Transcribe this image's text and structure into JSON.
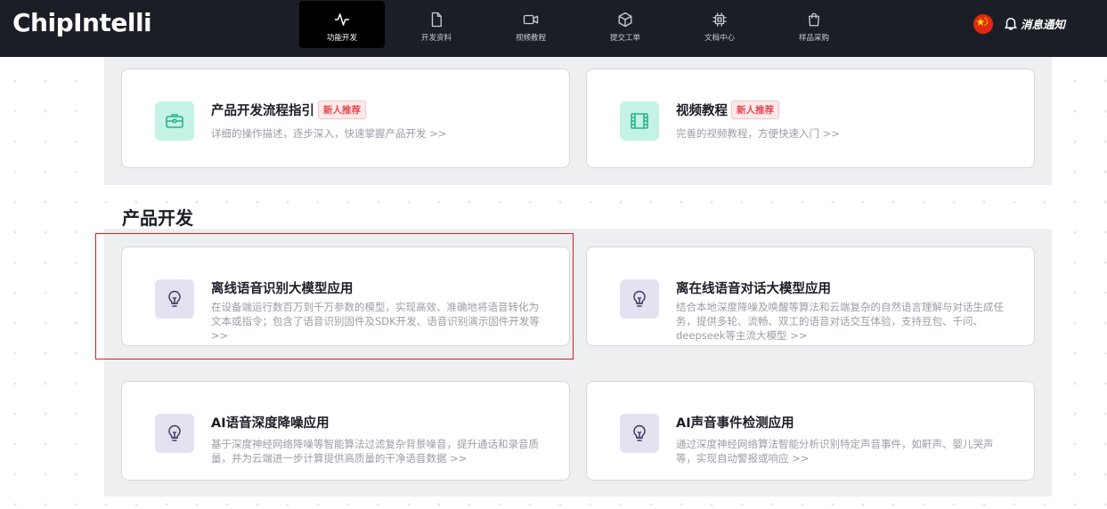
{
  "header": {
    "logo": "ChipIntelli",
    "nav": [
      {
        "label": "功能开发",
        "icon": "activity-pulse-icon",
        "active": true
      },
      {
        "label": "开发资料",
        "icon": "document-icon",
        "active": false
      },
      {
        "label": "视频教程",
        "icon": "video-camera-icon",
        "active": false
      },
      {
        "label": "提交工单",
        "icon": "box-3d-icon",
        "active": false
      },
      {
        "label": "文档中心",
        "icon": "chip-icon",
        "active": false
      },
      {
        "label": "样品采购",
        "icon": "shopping-bag-icon",
        "active": false
      }
    ],
    "notify_label": "消息通知",
    "flag_icon": "china-flag-icon"
  },
  "top_cards": [
    {
      "title": "产品开发流程指引",
      "badge": "新人推荐",
      "desc": "详细的操作描述，逐步深入，快速掌握产品开发 >>",
      "icon": "toolbox-icon"
    },
    {
      "title": "视频教程",
      "badge": "新人推荐",
      "desc": "完善的视频教程，方便快速入门 >>",
      "icon": "film-icon"
    }
  ],
  "section": {
    "title": "产品开发"
  },
  "product_cards": [
    {
      "title": "离线语音识别大模型应用",
      "desc": "在设备端运行数百万到千万参数的模型，实现高效、准确地将语音转化为文本或指令；包含了语音识别固件及SDK开发、语音识别演示固件开发等 >>",
      "icon": "lightbulb-icon"
    },
    {
      "title": "离在线语音对话大模型应用",
      "desc": "结合本地深度降噪及唤醒等算法和云端复杂的自然语言理解与对话生成任务，提供多轮、流畅、双工的语音对话交互体验，支持豆包、千问、deepseek等主流大模型 >>",
      "icon": "lightbulb-icon"
    },
    {
      "title": "AI语音深度降噪应用",
      "desc": "基于深度神经网络降噪等智能算法过滤复杂背景噪音，提升通话和录音质量，并为云端进一步计算提供高质量的干净语音数据 >>",
      "icon": "lightbulb-icon"
    },
    {
      "title": "AI声音事件检测应用",
      "desc": "通过深度神经网络算法智能分析识别特定声音事件，如鼾声、婴儿哭声等，实现自动警报或响应 >>",
      "icon": "lightbulb-icon"
    }
  ],
  "colors": {
    "header_bg": "#1c1e27",
    "badge_text": "#e4474e",
    "icon_green": "#c4f3e6",
    "icon_purple": "#e4e1f1",
    "highlight_border": "#d91c1c"
  }
}
